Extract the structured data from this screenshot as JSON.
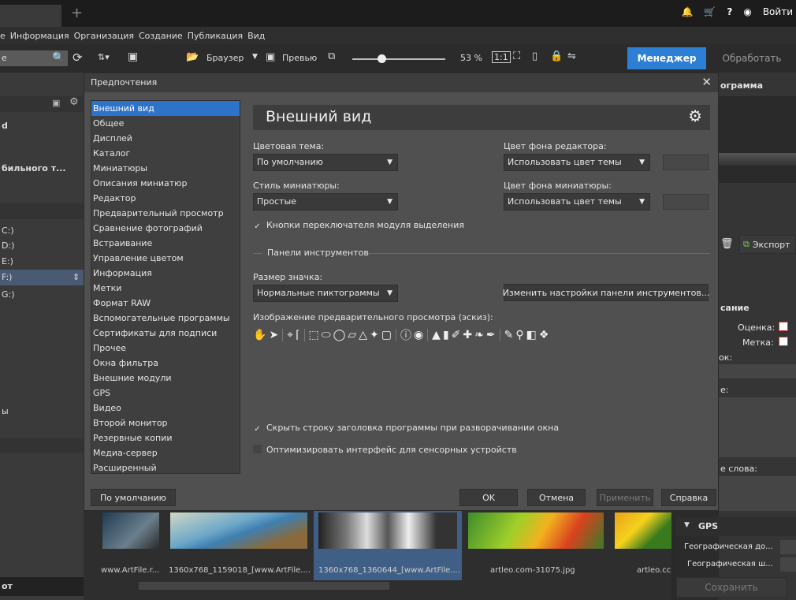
{
  "top_bar": {
    "login_label": "Войти",
    "icons": [
      "bell-icon",
      "cart-icon",
      "help-icon",
      "user-icon"
    ]
  },
  "menu": [
    "е",
    "Информация",
    "Организация",
    "Создание",
    "Публикация",
    "Вид"
  ],
  "toolbar": {
    "browser_label": "Браузер",
    "preview_label": "Превью",
    "zoom_value": "53 %",
    "zoom_fraction": 0.3,
    "manager_label": "Менеджер",
    "process_label": "Обработать",
    "search_value": "е"
  },
  "left_panel": {
    "rows": [
      "d",
      "бильного т...",
      "C:)",
      "D:)",
      "E:)",
      "F:)",
      "G:)",
      "ы",
      "от"
    ]
  },
  "right_panel": {
    "rows": [
      "ограмма",
      "Экспорт",
      "сание",
      "Оценка:",
      "Метка:",
      "ок:",
      "е:",
      "е слова:",
      "GPS",
      "Географическая до...",
      "Географическая ш...",
      "Сохранить"
    ]
  },
  "filmstrip": {
    "names": [
      "www.ArtFile.r...",
      "1360x768_1159018_[www.ArtFile....",
      "1360x768_1360644_[www.ArtFile....",
      "artleo.com-31075.jpg",
      "artleo.cc"
    ]
  },
  "dialog": {
    "title": "Предпочтения",
    "categories": [
      "Внешний вид",
      "Общее",
      "Дисплей",
      "Каталог",
      "Миниатюры",
      "Описания миниатюр",
      "Редактор",
      "Предварительный просмотр",
      "Сравнение фотографий",
      "Встраивание",
      "Управление цветом",
      "Информация",
      "Метки",
      "Формат RAW",
      "Вспомогательные программы",
      "Сертификаты для подписи",
      "Прочее",
      "Окна фильтра",
      "Внешние модули",
      "GPS",
      "Видео",
      "Второй монитор",
      "Резервные копии",
      "Медиа-сервер",
      "Расширенный"
    ],
    "selected_index": 0,
    "heading": "Внешний вид",
    "color_theme_label": "Цветовая тема:",
    "color_theme_value": "По умолчанию",
    "editor_bg_label": "Цвет фона редактора:",
    "editor_bg_value": "Использовать цвет темы",
    "thumb_style_label": "Стиль миниатюры:",
    "thumb_style_value": "Простые",
    "thumb_bg_label": "Цвет фона миниатюры:",
    "thumb_bg_value": "Использовать цвет темы",
    "selection_switch_label": "Кнопки переключателя модуля выделения",
    "selection_switch_checked": true,
    "toolbars_section": "Панели инструментов",
    "icon_size_label": "Размер значка:",
    "icon_size_value": "Нормальные пиктограммы",
    "change_toolbar_button": "Изменить настройки панели инструментов...",
    "preview_image_label": "Изображение предварительного просмотра (эскиз):",
    "hide_title_label": "Скрыть строку заголовка программы при разворачивании окна",
    "hide_title_checked": true,
    "touch_label": "Оптимизировать интерфейс для сенсорных устройств",
    "touch_checked": false,
    "default_button": "По умолчанию",
    "ok_button": "OK",
    "cancel_button": "Отмена",
    "apply_button": "Применить",
    "help_button": "Справка"
  }
}
